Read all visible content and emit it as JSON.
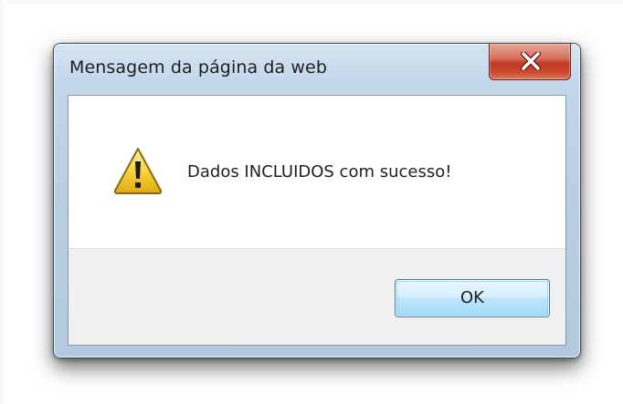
{
  "dialog": {
    "title": "Mensagem da página da web",
    "message": "Dados INCLUIDOS com sucesso!",
    "icon": "warning-icon",
    "buttons": {
      "ok_label": "OK"
    },
    "close_icon": "close-icon"
  },
  "colors": {
    "close_button": "#c23a22",
    "ok_button_border": "#3c7fb1",
    "warning_fill": "#f6d43a",
    "frame": "#bccfe3"
  }
}
